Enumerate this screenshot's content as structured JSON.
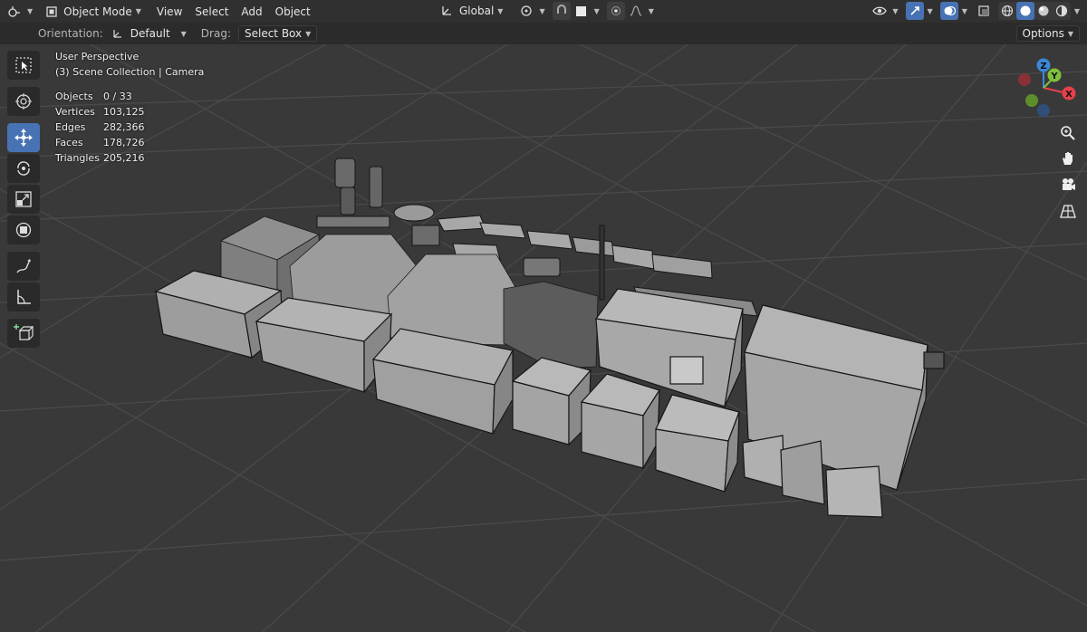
{
  "header": {
    "editor_icon": "viewport-editor-icon",
    "mode_label": "Object Mode",
    "menus": [
      "View",
      "Select",
      "Add",
      "Object"
    ],
    "transform_orientation": "Global",
    "icons_right": [
      "visibility-icon",
      "gizmo-icon",
      "overlay-icon",
      "xray-icon",
      "wireframe-shading-icon",
      "solid-shading-icon",
      "material-shading-icon",
      "rendered-shading-icon"
    ]
  },
  "tool_settings": {
    "orientation_label": "Orientation:",
    "orientation_value": "Default",
    "drag_label": "Drag:",
    "drag_value": "Select Box",
    "options_label": "Options"
  },
  "viewport": {
    "perspective": "User Perspective",
    "collection": "(3) Scene Collection | Camera",
    "stats": [
      {
        "label": "Objects",
        "value": "0 / 33"
      },
      {
        "label": "Vertices",
        "value": "103,125"
      },
      {
        "label": "Edges",
        "value": "282,366"
      },
      {
        "label": "Faces",
        "value": "178,726"
      },
      {
        "label": "Triangles",
        "value": "205,216"
      }
    ],
    "gizmo_axes": {
      "x": "X",
      "y": "Y",
      "z": "Z"
    }
  },
  "tools": [
    "select-box-tool",
    "cursor-tool",
    "move-tool",
    "rotate-tool",
    "scale-tool",
    "transform-tool",
    "annotate-tool",
    "measure-tool",
    "add-cube-tool"
  ],
  "colors": {
    "accent": "#4772b3",
    "axis_x": "#e8404a",
    "axis_y": "#7fc13a",
    "axis_z": "#3d87d8",
    "grid": "#4a4a4a",
    "mesh_face": "#a4a4a4",
    "mesh_wire": "#1a1a1a"
  }
}
